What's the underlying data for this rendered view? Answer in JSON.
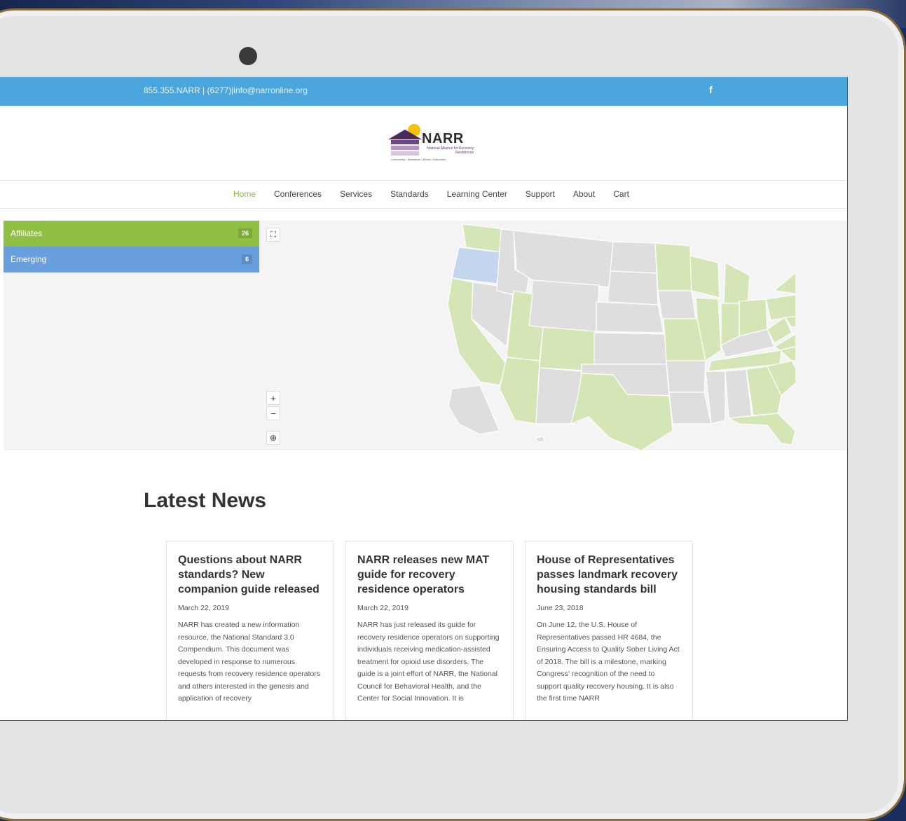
{
  "topbar": {
    "contact": "855.355.NARR | (6277)|info@narronline.org",
    "social_icon": "f"
  },
  "logo": {
    "name": "NARR",
    "subtitle": "National Alliance for Recovery Residences",
    "tagline": "Community • Standards • Ethics • Education"
  },
  "nav": {
    "items": [
      {
        "label": "Home",
        "active": true
      },
      {
        "label": "Conferences"
      },
      {
        "label": "Services"
      },
      {
        "label": "Standards"
      },
      {
        "label": "Learning Center"
      },
      {
        "label": "Support"
      },
      {
        "label": "About"
      },
      {
        "label": "Cart"
      }
    ]
  },
  "map": {
    "legend": [
      {
        "label": "Affiliates",
        "count": "26",
        "color": "#90c043"
      },
      {
        "label": "Emerging",
        "count": "6",
        "color": "#6a9fdd"
      }
    ],
    "controls": {
      "fullscreen": "⛶",
      "zoom_in": "+",
      "zoom_out": "−",
      "reset": "⊕"
    },
    "colors": {
      "affiliate": "#d4e6b5",
      "emerging": "#c3d6ee",
      "other": "#dedede"
    }
  },
  "news": {
    "heading": "Latest News",
    "articles": [
      {
        "title": "Questions about NARR standards? New companion guide released",
        "date": "March 22, 2019",
        "excerpt": "NARR has created a new information resource, the National Standard 3.0 Compendium. This document was developed in response to numerous requests from recovery residence operators and others interested in the genesis and application of recovery"
      },
      {
        "title": "NARR releases new MAT guide for recovery residence operators",
        "date": "March 22, 2019",
        "excerpt": "NARR has just released its guide for recovery residence operators on supporting individuals receiving medication-assisted treatment for opioid use disorders. The guide is a joint effort of NARR, the National Council for Behavioral Health, and the Center for Social Innovation. It is"
      },
      {
        "title": "House of Representatives passes landmark recovery housing standards bill",
        "date": "June 23, 2018",
        "excerpt": "On June 12, the U.S. House of Representatives passed HR 4684, the Ensuring Access to Quality Sober Living Act of 2018. The bill is a milestone, marking Congress' recognition of the need to support quality recovery housing. It is also the first time NARR"
      }
    ]
  }
}
